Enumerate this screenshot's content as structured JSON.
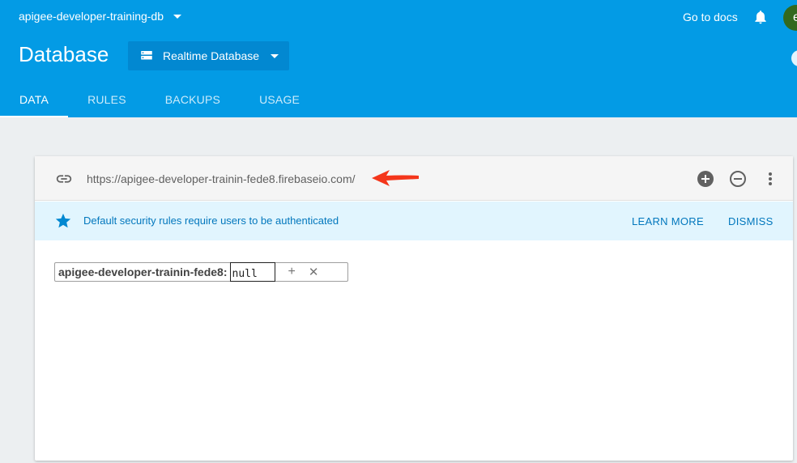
{
  "header": {
    "project_name": "apigee-developer-training-db",
    "go_to_docs": "Go to docs",
    "avatar_initial": "e",
    "title": "Database",
    "db_selector": "Realtime Database",
    "tabs": [
      {
        "label": "DATA",
        "active": true
      },
      {
        "label": "RULES",
        "active": false
      },
      {
        "label": "BACKUPS",
        "active": false
      },
      {
        "label": "USAGE",
        "active": false
      }
    ]
  },
  "card": {
    "url": "https://apigee-developer-trainin-fede8.firebaseio.com/",
    "banner": {
      "text": "Default security rules require users to be authenticated",
      "learn_more": "LEARN MORE",
      "dismiss": "DISMISS"
    },
    "node": {
      "key": "apigee-developer-trainin-fede8:",
      "value": "null",
      "add_symbol": "+",
      "remove_symbol": "✕"
    }
  },
  "icons": [
    "chevron-down-icon",
    "bell-icon",
    "database-icon",
    "link-icon",
    "red-arrow-icon",
    "add-circle-icon",
    "remove-circle-icon",
    "more-vert-icon",
    "star-icon"
  ],
  "colors": {
    "header_bg": "#039be5",
    "selector_bg": "#0288d1",
    "banner_bg": "#e1f5fe",
    "banner_text": "#0277bd",
    "avatar_bg": "#33691e",
    "arrow": "#f4361b"
  }
}
